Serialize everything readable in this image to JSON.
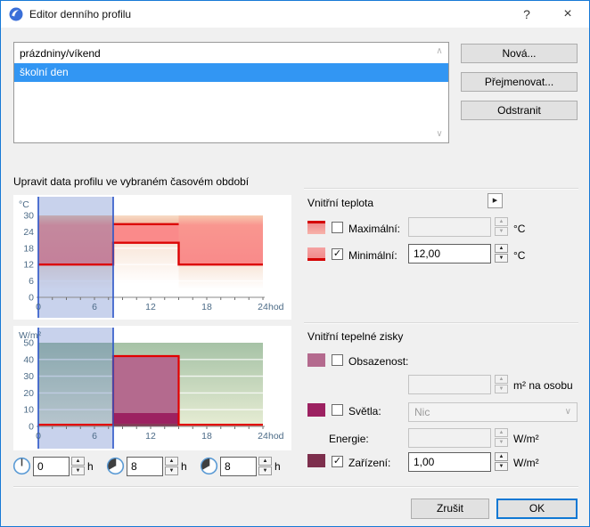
{
  "window": {
    "title": "Editor denního profilu"
  },
  "icons": {
    "help": "?",
    "close": "×",
    "arrow_right": "▶",
    "spin_up": "▲",
    "spin_down": "▼",
    "check": "✓",
    "chevron_down": "∨",
    "scroll_up": "∧",
    "scroll_down": "∨"
  },
  "colors": {
    "window_border": "#1779d6",
    "selection_blue": "#3296f3",
    "chart_selection_line": "#2b55c8",
    "profile_red": "#dc0303",
    "salmon": "#fa8a8a",
    "occupancy": "#b46a8e",
    "lights": "#9c2161",
    "equipment": "#7d2f4d",
    "green_top": "#a6c2a6"
  },
  "profile_list": {
    "items": [
      {
        "label": "prázdniny/víkend",
        "selected": false
      },
      {
        "label": "školní den",
        "selected": true
      }
    ]
  },
  "list_buttons": {
    "new": "Nová...",
    "rename": "Přejmenovat...",
    "delete": "Odstranit"
  },
  "section_label": "Upravit data profilu ve vybraném časovém období",
  "temperature": {
    "title": "Vnitřní teplota",
    "max": {
      "label": "Maximální:",
      "checked": false,
      "value": "",
      "unit": "°C"
    },
    "min": {
      "label": "Minimální:",
      "checked": true,
      "value": "12,00",
      "unit": "°C"
    }
  },
  "gains": {
    "title": "Vnitřní tepelné zisky",
    "occupancy": {
      "label": "Obsazenost:",
      "checked": false,
      "value": "",
      "unit": "m² na osobu"
    },
    "lights": {
      "label": "Světla:",
      "checked": false,
      "dropdown_value": "Nic"
    },
    "energy": {
      "label": "Energie:",
      "value": "",
      "unit": "W/m²"
    },
    "equipment": {
      "label": "Zařízení:",
      "checked": true,
      "value": "1,00",
      "unit": "W/m²"
    }
  },
  "time_controls": [
    {
      "value": "0",
      "unit": "h"
    },
    {
      "value": "8",
      "unit": "h"
    },
    {
      "value": "8",
      "unit": "h"
    }
  ],
  "footer": {
    "cancel": "Zrušit",
    "ok": "OK"
  },
  "chart_data": [
    {
      "type": "area",
      "name": "indoor-temperature-profile",
      "title": "",
      "ylabel": "°C",
      "xlabel": "hod",
      "x_range": [
        0,
        24
      ],
      "x_ticks": [
        0,
        6,
        12,
        18,
        24
      ],
      "y_ticks": [
        0,
        6,
        12,
        18,
        24,
        30
      ],
      "selection": [
        0,
        8
      ],
      "gridlines": [
        6,
        12,
        18,
        24
      ],
      "fills": [
        {
          "from": 0,
          "to": 8,
          "top": 12,
          "bottom": 0,
          "fill": "grad:lightFade",
          "layer": "under"
        },
        {
          "from": 8,
          "to": 15,
          "top": 20,
          "bottom": 0,
          "fill": "grad:lightFade",
          "layer": "under"
        },
        {
          "from": 15,
          "to": 24,
          "top": 12,
          "bottom": 0,
          "fill": "grad:lightFade",
          "layer": "under"
        },
        {
          "from": 0,
          "to": 8,
          "top": 30,
          "bottom": 12,
          "fill": "grad:salmonMain",
          "layer": "over"
        },
        {
          "from": 8,
          "to": 15,
          "top": 30,
          "bottom": 26.8,
          "fill": "grad:peach",
          "layer": "over"
        },
        {
          "from": 8,
          "to": 15,
          "top": 26.8,
          "bottom": 20,
          "fill": "#fa8a8a",
          "layer": "over"
        },
        {
          "from": 15,
          "to": 24,
          "top": 30,
          "bottom": 12,
          "fill": "grad:salmonMain",
          "layer": "over"
        }
      ],
      "lines": [
        {
          "name": "minimum-temperature",
          "color": "#dc0303",
          "width": 2.4,
          "points": [
            [
              0,
              12
            ],
            [
              8,
              12
            ],
            [
              8,
              20
            ],
            [
              15,
              20
            ],
            [
              15,
              12
            ],
            [
              24,
              12
            ]
          ]
        },
        {
          "name": "maximum-temperature",
          "color": "#dc0303",
          "width": 2.4,
          "points": [
            [
              8,
              26.8
            ],
            [
              15,
              26.8
            ]
          ]
        }
      ]
    },
    {
      "type": "area",
      "name": "internal-heat-gains-profile",
      "title": "",
      "ylabel": "W/m²",
      "xlabel": "hod",
      "x_range": [
        0,
        24
      ],
      "x_ticks": [
        0,
        6,
        12,
        18,
        24
      ],
      "y_ticks": [
        0,
        10,
        20,
        30,
        40,
        50
      ],
      "selection": [
        0,
        8
      ],
      "background": {
        "top": 50,
        "bottom": 0,
        "fill": "grad:green"
      },
      "gridlines": [
        10,
        20,
        30,
        40
      ],
      "fills": [
        {
          "from": 8,
          "to": 15,
          "top": 42,
          "bottom": 8,
          "fill": "#b46a8e",
          "layer": "over"
        },
        {
          "from": 8,
          "to": 15,
          "top": 8,
          "bottom": 1.5,
          "fill": "#9c2161",
          "layer": "over"
        },
        {
          "from": 8,
          "to": 15,
          "top": 1.5,
          "bottom": 0,
          "fill": "#7d2f4d",
          "layer": "over"
        }
      ],
      "lines": [
        {
          "name": "total-gains-outline",
          "color": "#e20000",
          "width": 2.2,
          "points": [
            [
              0,
              1
            ],
            [
              8,
              1
            ],
            [
              8,
              42
            ],
            [
              15,
              42
            ],
            [
              15,
              1
            ],
            [
              24,
              1
            ]
          ]
        }
      ]
    }
  ]
}
